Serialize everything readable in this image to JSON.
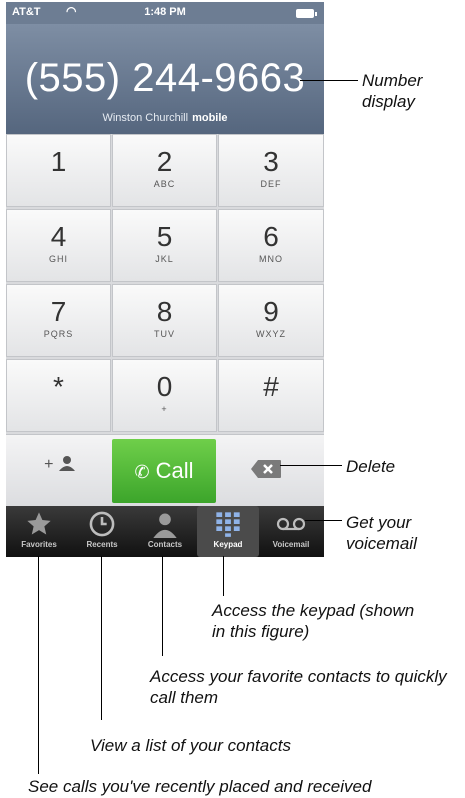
{
  "status": {
    "carrier": "AT&T",
    "time": "1:48 PM"
  },
  "display": {
    "number": "(555) 244-9663",
    "contact_name": "Winston Churchill",
    "contact_type": "mobile"
  },
  "keys": [
    {
      "digit": "1",
      "letters": ""
    },
    {
      "digit": "2",
      "letters": "ABC"
    },
    {
      "digit": "3",
      "letters": "DEF"
    },
    {
      "digit": "4",
      "letters": "GHI"
    },
    {
      "digit": "5",
      "letters": "JKL"
    },
    {
      "digit": "6",
      "letters": "MNO"
    },
    {
      "digit": "7",
      "letters": "PQRS"
    },
    {
      "digit": "8",
      "letters": "TUV"
    },
    {
      "digit": "9",
      "letters": "WXYZ"
    },
    {
      "digit": "*",
      "letters": ""
    },
    {
      "digit": "0",
      "letters": "+"
    },
    {
      "digit": "#",
      "letters": ""
    }
  ],
  "bottom_row": {
    "add_contact_label": "+",
    "call_label": "Call"
  },
  "tabs": [
    {
      "label": "Favorites",
      "icon": "star-icon"
    },
    {
      "label": "Recents",
      "icon": "clock-icon"
    },
    {
      "label": "Contacts",
      "icon": "person-icon"
    },
    {
      "label": "Keypad",
      "icon": "keypad-icon"
    },
    {
      "label": "Voicemail",
      "icon": "voicemail-icon"
    }
  ],
  "active_tab": "Keypad",
  "callouts": {
    "number_display": "Number display",
    "delete": "Delete",
    "voicemail": "Get your voicemail",
    "keypad": "Access the keypad (shown in this figure)",
    "favorites": "Access your favorite contacts to quickly call them",
    "contacts": "View a list of your contacts",
    "recents": "See calls you've recently placed and received"
  },
  "colors": {
    "display_bg": "#6b7b91",
    "call_button": "#4cb834",
    "tabbar_bg": "#1c1c1c"
  }
}
